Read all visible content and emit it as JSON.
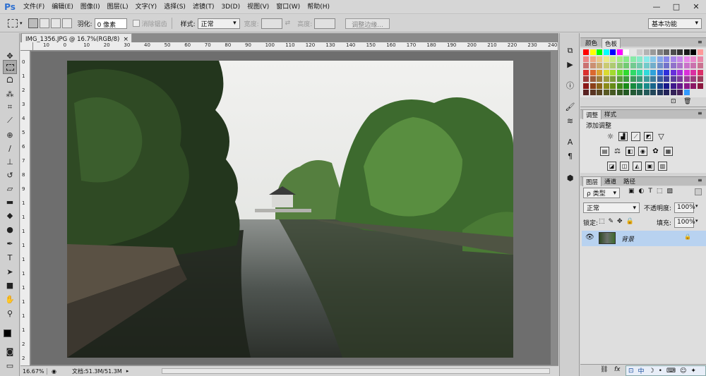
{
  "app": {
    "logo": "Ps"
  },
  "menu": [
    "文件(F)",
    "编辑(E)",
    "图像(I)",
    "图层(L)",
    "文字(Y)",
    "选择(S)",
    "滤镜(T)",
    "3D(D)",
    "视图(V)",
    "窗口(W)",
    "帮助(H)"
  ],
  "window_controls": {
    "minimize": "—",
    "restore": "□",
    "close": "✕"
  },
  "options": {
    "feather_label": "羽化:",
    "feather_value": "0 像素",
    "antialias_label": "消除锯齿",
    "style_label": "样式:",
    "style_value": "正常",
    "width_label": "宽度:",
    "height_label": "高度:",
    "refine_button": "调整边缘...",
    "workspace": "基本功能"
  },
  "document": {
    "tab_title": "IMG_1356.JPG @ 16.7%(RGB/8)",
    "tab_close": "×",
    "zoom": "16.67%",
    "doc_info": "文档:51.3M/51.3M"
  },
  "ruler": {
    "top": [
      "10",
      "0",
      "10",
      "20",
      "30",
      "40",
      "50",
      "60",
      "70",
      "80",
      "90",
      "100",
      "110",
      "120",
      "130",
      "140",
      "150",
      "160",
      "170",
      "180",
      "190",
      "200",
      "210",
      "220",
      "230",
      "240"
    ],
    "left": [
      "0",
      "1",
      "2",
      "3",
      "4",
      "5",
      "6",
      "7",
      "8",
      "9",
      "1",
      "1",
      "1",
      "1",
      "1",
      "1",
      "1",
      "1",
      "1",
      "1",
      "2",
      "2"
    ]
  },
  "panels": {
    "color_tabs": [
      "颜色",
      "色板"
    ],
    "adjust_tabs": [
      "调整",
      "样式"
    ],
    "adjust_title": "添加调整",
    "layers_tabs": [
      "图层",
      "通道",
      "路径"
    ],
    "layers_filter": "ρ 类型",
    "blend_mode": "正常",
    "opacity_label": "不透明度:",
    "opacity_value": "100%",
    "lock_label": "锁定:",
    "fill_label": "填充:",
    "fill_value": "100%",
    "layer_name": "背景"
  },
  "ime": {
    "mode": "中"
  },
  "colors": {
    "selected_layer": "#b8d2f0",
    "panel_bg": "#d3d3d3",
    "canvas_bg": "#6e6e6e"
  }
}
